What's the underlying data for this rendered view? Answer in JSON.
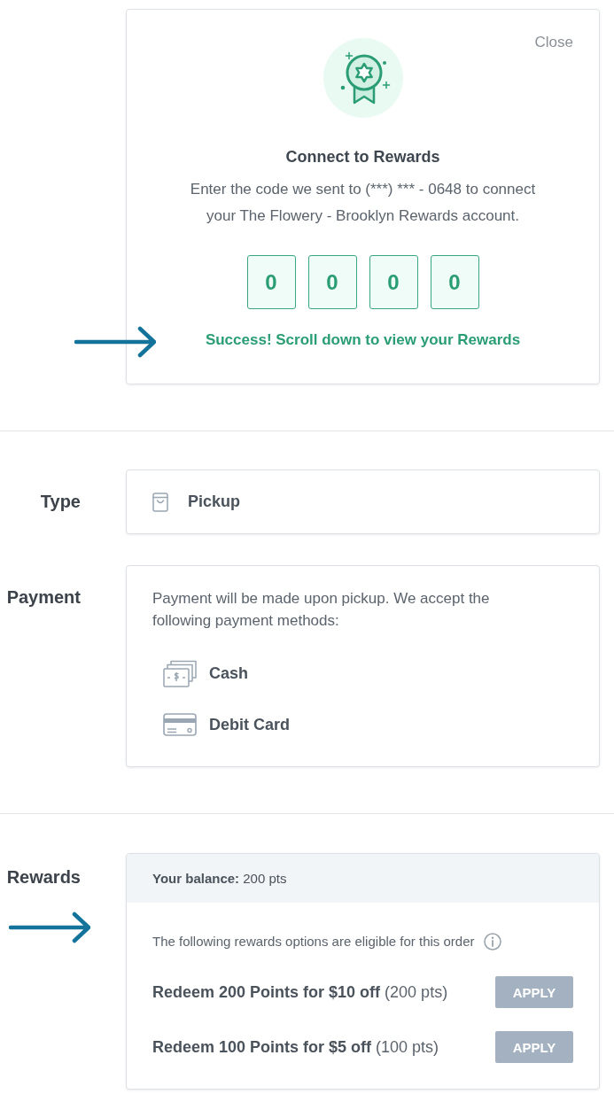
{
  "rewards_modal": {
    "close": "Close",
    "title": "Connect to Rewards",
    "message": "Enter the code we sent to (***) *** - 0648 to connect your The Flowery - Brooklyn Rewards account.",
    "code_digits": [
      {
        "value": "0"
      },
      {
        "value": "0"
      },
      {
        "value": "0"
      },
      {
        "value": "0"
      }
    ],
    "status": "Success! Scroll down to view your Rewards"
  },
  "type_section": {
    "label": "Type",
    "option": "Pickup"
  },
  "payment_section": {
    "label": "Payment",
    "note": "Payment will be made upon pickup. We accept the following payment methods:",
    "methods": [
      {
        "kind": "cash",
        "label": "Cash"
      },
      {
        "kind": "card",
        "label": "Debit Card"
      }
    ]
  },
  "rewards_section": {
    "label": "Rewards",
    "balance": "**Your balance:** 200 pts",
    "eligibility_note": "The following rewards options are eligible for this order",
    "options": [
      {
        "text": "**Redeem 200 Points for $10 off** (200 pts)",
        "button": "APPLY"
      },
      {
        "text": "**Redeem 100 Points for $5 off** (100 pts)",
        "button": "APPLY"
      }
    ]
  }
}
